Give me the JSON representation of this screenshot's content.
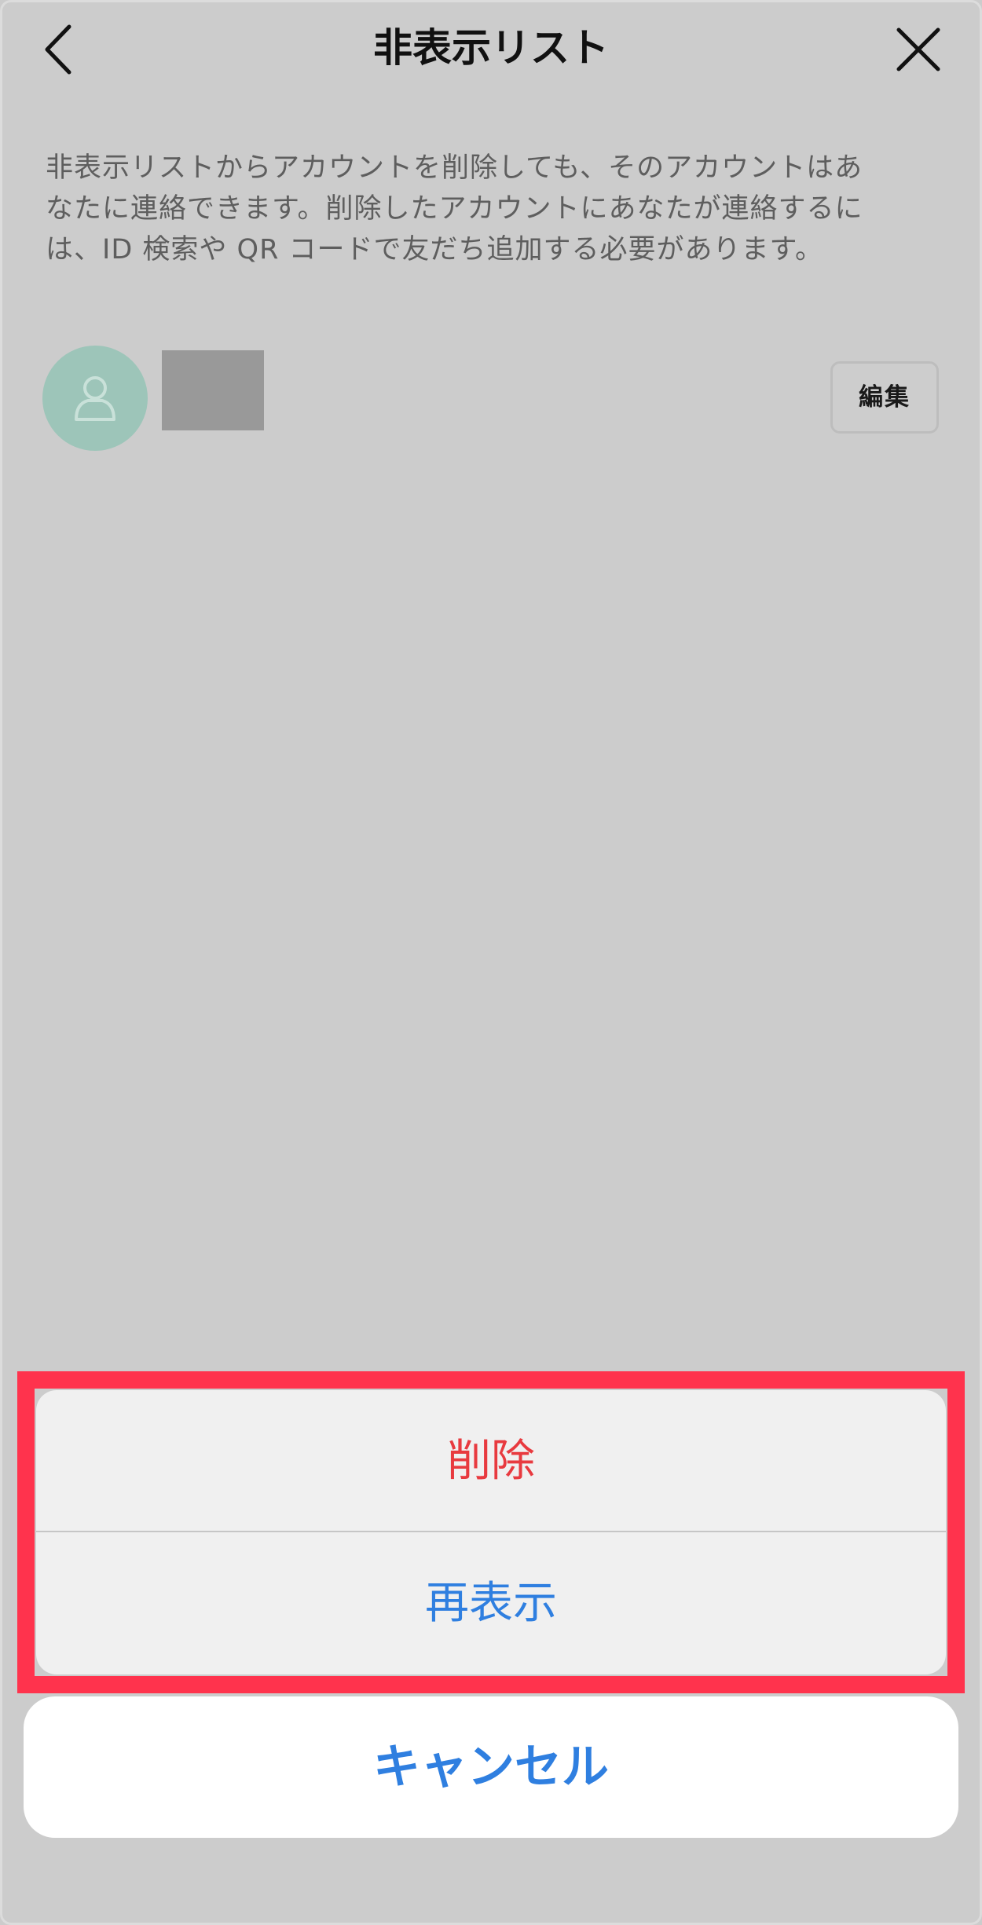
{
  "header": {
    "title": "非表示リスト",
    "back_icon": "chevron-left-icon",
    "close_icon": "close-icon"
  },
  "notice": {
    "lines": [
      "非表示リストからアカウントを削除しても、そのアカウントはあ",
      "なたに連絡できます。削除したアカウントにあなたが連絡するに",
      "は、ID 検索や QR コードで友だち追加する必要があります。"
    ]
  },
  "hidden_list": {
    "items": [
      {
        "avatar_icon": "person-icon",
        "edit_label": "編集"
      }
    ]
  },
  "action_sheet": {
    "delete_label": "削除",
    "reshow_label": "再表示",
    "cancel_label": "キャンセル"
  },
  "colors": {
    "overlay": "#cccccc",
    "destructive": "#e83a3f",
    "action": "#2f7fe0",
    "highlight": "#ff334d",
    "avatar": "#9dc5b9"
  }
}
